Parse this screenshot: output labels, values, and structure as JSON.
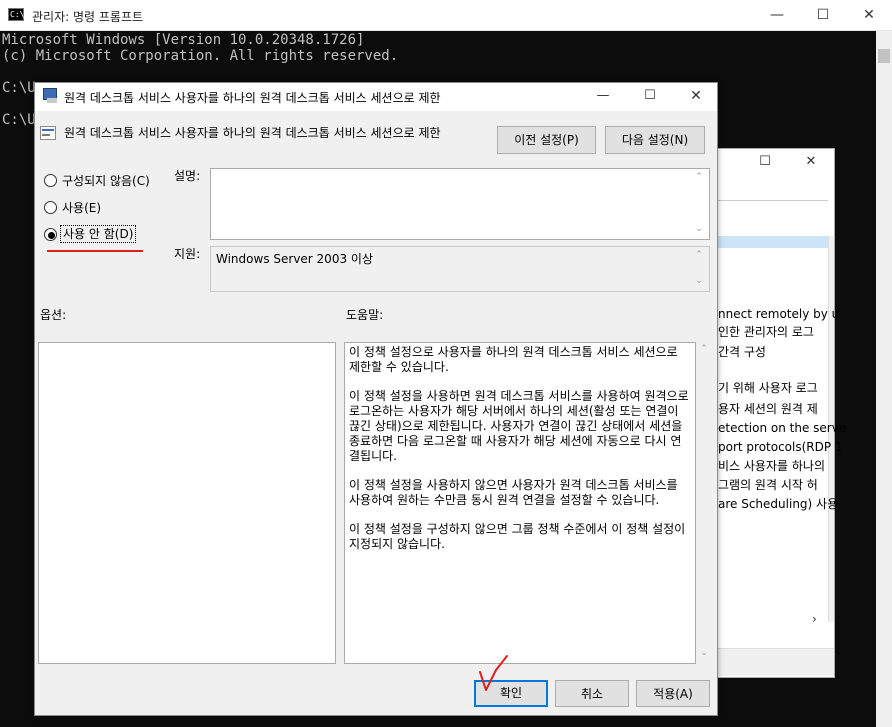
{
  "console": {
    "title": "관리자: 명령 프롬프트",
    "icon": "C:\\",
    "lines": [
      "Microsoft Windows [Version 10.0.20348.1726]",
      "(c) Microsoft Corporation. All rights reserved.",
      "",
      "C:\\U",
      "",
      "C:\\U"
    ]
  },
  "background_window": {
    "text_lines": [
      "nnect remotely by u",
      "인한 관리자의 로그",
      "간격 구성",
      "",
      "기 위해 사용자 로그",
      "용자 세션의 원격 제",
      "etection on the serve",
      "port protocols(RDP 1",
      "비스 사용자를 하나의",
      "그램의 원격 시작 허",
      "are Scheduling) 사용"
    ]
  },
  "dialog": {
    "title": "원격 데스크톱 서비스 사용자를 하나의 원격 데스크톱 서비스 세션으로 제한",
    "header_label": "원격 데스크톱 서비스 사용자를 하나의 원격 데스크톱 서비스 세션으로 제한",
    "prev_button": "이전 설정(P)",
    "next_button": "다음 설정(N)",
    "radio_not_configured": "구성되지 않음(C)",
    "radio_enabled": "사용(E)",
    "radio_disabled": "사용 안 함(D)",
    "selected": "disabled",
    "comment_label": "설명:",
    "supported_label": "지원:",
    "supported_value": "Windows Server 2003 이상",
    "options_label": "옵션:",
    "help_label": "도움말:",
    "help_paragraphs": [
      "이 정책 설정으로 사용자를 하나의 원격 데스크톱 서비스 세션으로 제한할 수 있습니다.",
      "이 정책 설정을 사용하면 원격 데스크톱 서비스를 사용하여 원격으로 로그온하는 사용자가 해당 서버에서 하나의 세션(활성 또는 연결이 끊긴 상태)으로 제한됩니다. 사용자가 연결이 끊긴 상태에서 세션을 종료하면 다음 로그온할 때 사용자가 해당 세션에 자동으로 다시 연결됩니다.",
      "이 정책 설정을 사용하지 않으면 사용자가 원격 데스크톱 서비스를 사용하여 원하는 수만큼 동시 원격 연결을 설정할 수 있습니다.",
      "이 정책 설정을 구성하지 않으면 그룹 정책 수준에서 이 정책 설정이 지정되지 않습니다."
    ],
    "ok_button": "확인",
    "cancel_button": "취소",
    "apply_button": "적용(A)"
  },
  "colors": {
    "annotation_red": "#e02020",
    "selection_blue": "#0078d7"
  }
}
